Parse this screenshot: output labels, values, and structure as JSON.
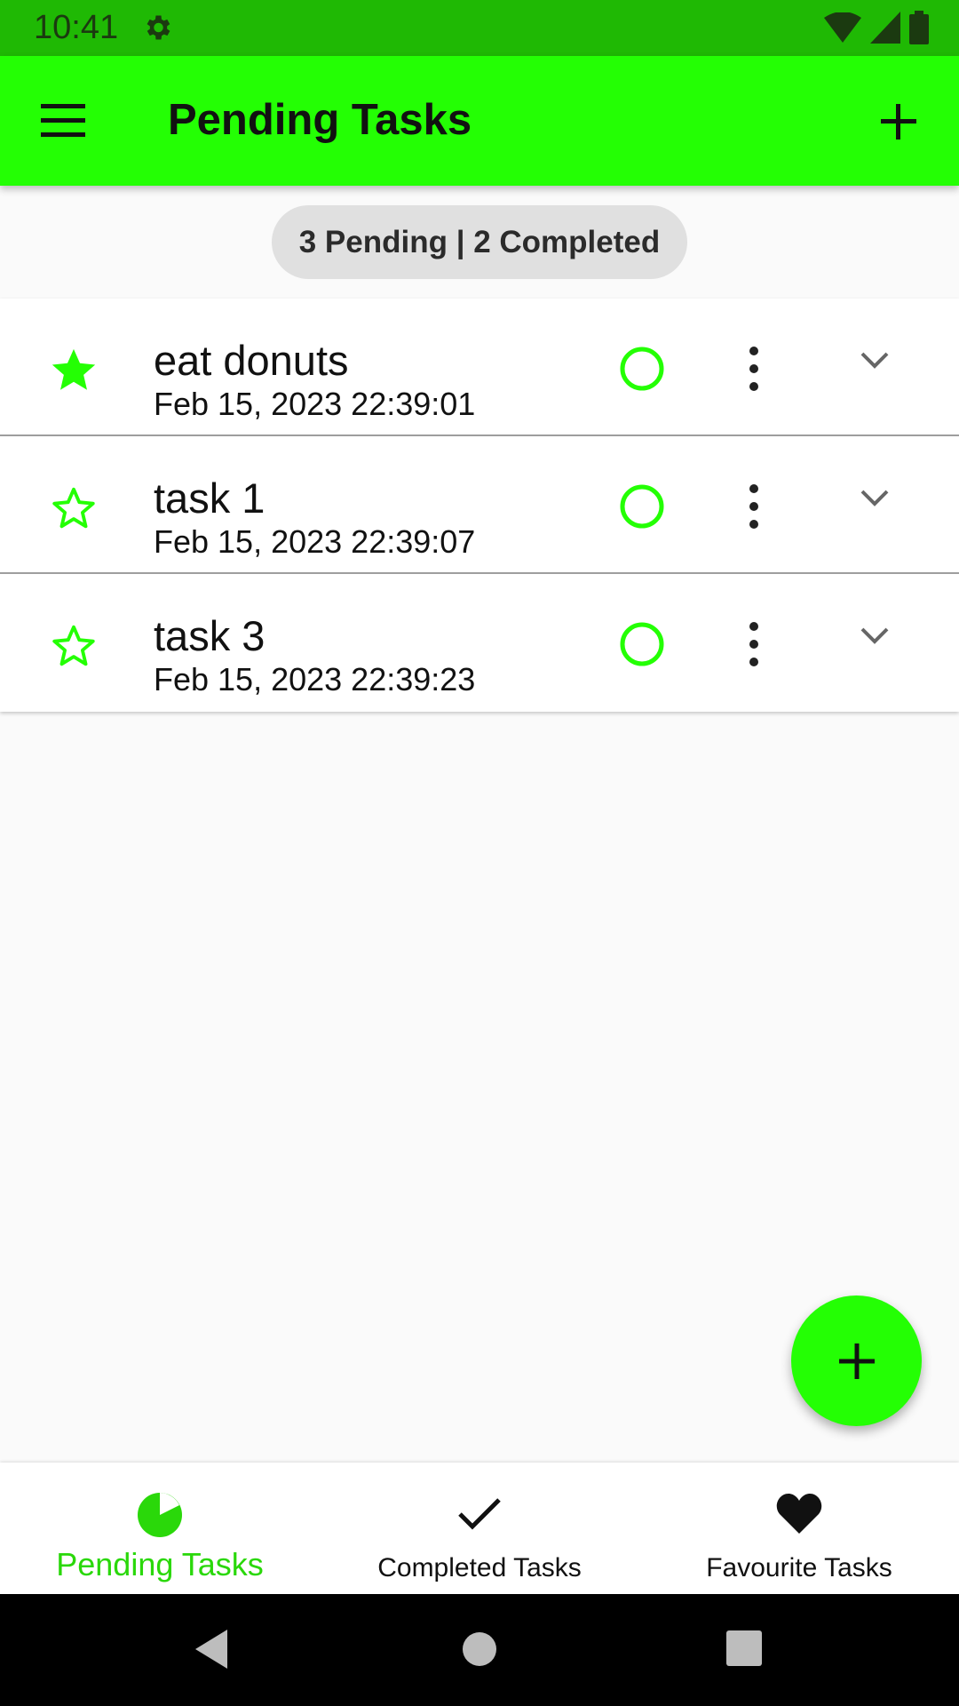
{
  "status_bar": {
    "time": "10:41"
  },
  "app_bar": {
    "title": "Pending Tasks"
  },
  "summary": {
    "text": "3 Pending | 2 Completed"
  },
  "tasks": [
    {
      "title": "eat donuts",
      "date": "Feb 15, 2023 22:39:01",
      "favourite": true
    },
    {
      "title": "task 1",
      "date": "Feb 15, 2023 22:39:07",
      "favourite": false
    },
    {
      "title": "task 3",
      "date": "Feb 15, 2023 22:39:23",
      "favourite": false
    }
  ],
  "bottom_nav": {
    "items": [
      {
        "label": "Pending Tasks",
        "icon": "pie-chart-icon",
        "active": true
      },
      {
        "label": "Completed Tasks",
        "icon": "check-icon",
        "active": false
      },
      {
        "label": "Favourite Tasks",
        "icon": "heart-icon",
        "active": false
      }
    ]
  },
  "colors": {
    "accent": "#24ff04",
    "status_bar": "#1fb904",
    "active_nav": "#2ad80a"
  }
}
